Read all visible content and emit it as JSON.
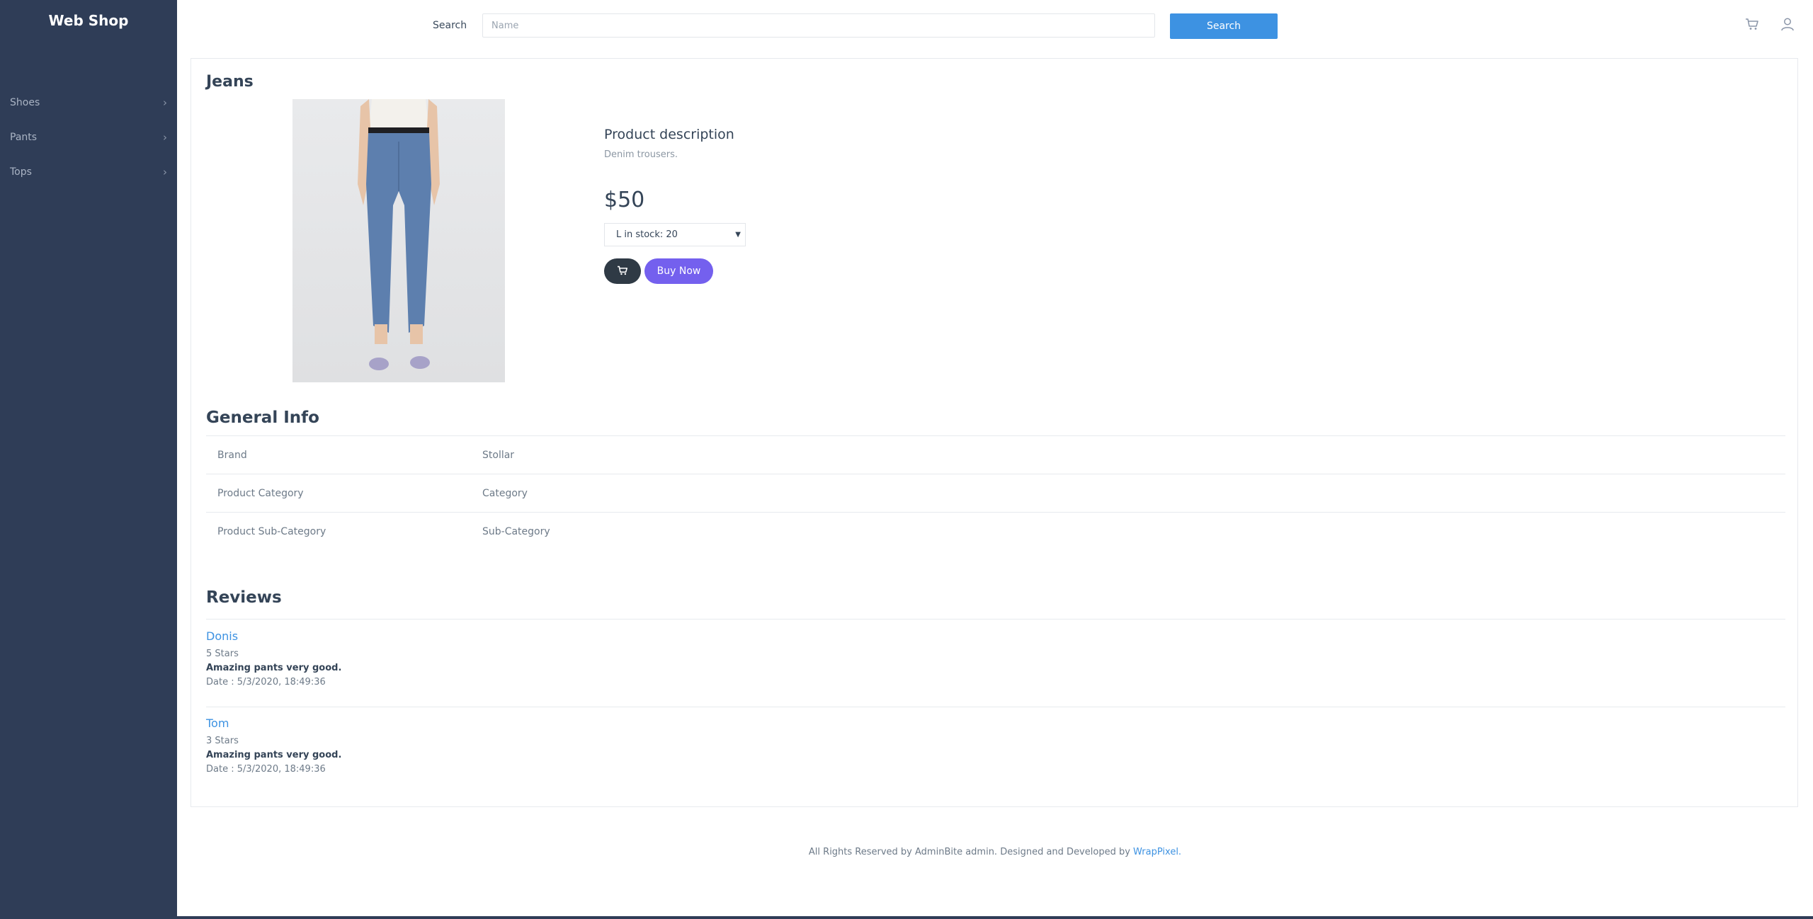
{
  "app": {
    "brand": "Web Shop"
  },
  "sidebar": {
    "items": [
      {
        "label": "Shoes"
      },
      {
        "label": "Pants"
      },
      {
        "label": "Tops"
      }
    ]
  },
  "header": {
    "search_label": "Search",
    "search_placeholder": "Name",
    "search_button": "Search",
    "cart_icon": "cart-icon",
    "user_icon": "user-icon"
  },
  "product": {
    "title": "Jeans",
    "description_title": "Product description",
    "description": "Denim trousers.",
    "price": "$50",
    "size_selected": "L in stock: 20",
    "buy_label": "Buy Now"
  },
  "general_info": {
    "title": "General Info",
    "rows": [
      {
        "key": "Brand",
        "value": "Stollar"
      },
      {
        "key": "Product Category",
        "value": "Category"
      },
      {
        "key": "Product Sub-Category",
        "value": "Sub-Category"
      }
    ]
  },
  "reviews": {
    "title": "Reviews",
    "items": [
      {
        "author": "Donis",
        "stars": "5 Stars",
        "text": "Amazing pants very good.",
        "date": "Date : 5/3/2020, 18:49:36"
      },
      {
        "author": "Tom",
        "stars": "3 Stars",
        "text": "Amazing pants very good.",
        "date": "Date : 5/3/2020, 18:49:36"
      }
    ]
  },
  "footer": {
    "text": "All Rights Reserved by AdminBite admin. Designed and Developed by ",
    "link": "WrapPixel."
  },
  "colors": {
    "sidebar": "#2f3d57",
    "primary": "#3d92e2",
    "buy": "#7460ee",
    "dark_button": "#2f3a45"
  }
}
